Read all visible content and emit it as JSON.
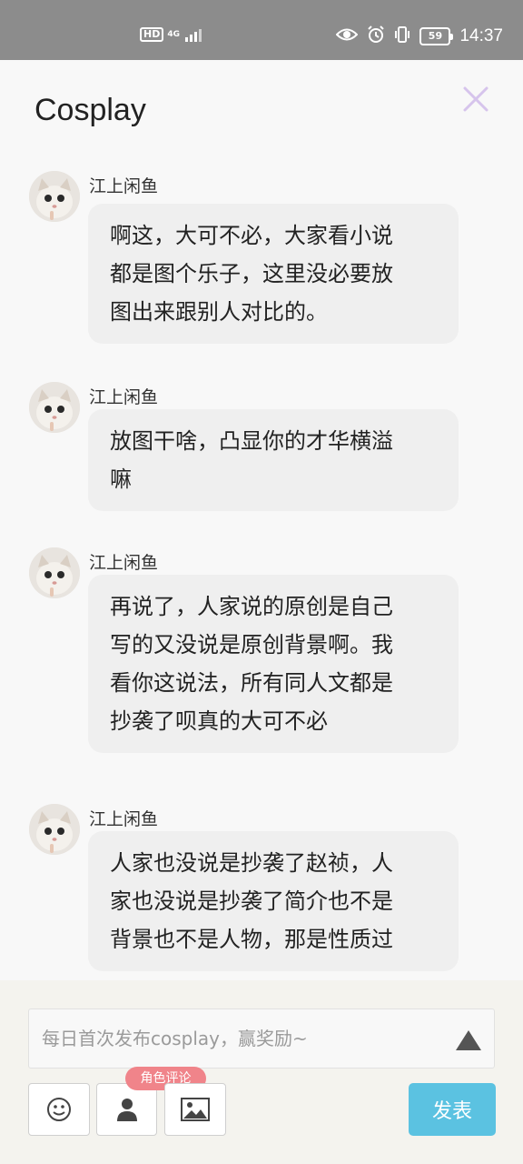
{
  "status_bar": {
    "hd": "HD",
    "network": "4G",
    "battery": "59",
    "time": "14:37"
  },
  "header": {
    "title": "Cosplay"
  },
  "messages": [
    {
      "user": "江上闲鱼",
      "lines": [
        "啊这，大可不必，大家看小说",
        "都是图个乐子，这里没必要放",
        "图出来跟别人对比的。"
      ]
    },
    {
      "user": "江上闲鱼",
      "lines": [
        "放图干啥，凸显你的才华横溢",
        "嘛"
      ]
    },
    {
      "user": "江上闲鱼",
      "lines": [
        "再说了，人家说的原创是自己",
        "写的又没说是原创背景啊。我",
        "看你这说法，所有同人文都是",
        "抄袭了呗真的大可不必"
      ]
    },
    {
      "user": "江上闲鱼",
      "lines": [
        "人家也没说是抄袭了赵祯，人",
        "家也没说是抄袭了简介也不是",
        "背景也不是人物，那是性质过"
      ]
    }
  ],
  "composer": {
    "placeholder": "每日首次发布cosplay，赢奖励~",
    "role_tag": "角色评论",
    "publish_label": "发表"
  },
  "colors": {
    "status_bar": "#8c8c8c",
    "close_icon": "#d6c4ec",
    "bubble": "#efefef",
    "role_tag": "#f0848a",
    "publish": "#5bc2e1"
  }
}
